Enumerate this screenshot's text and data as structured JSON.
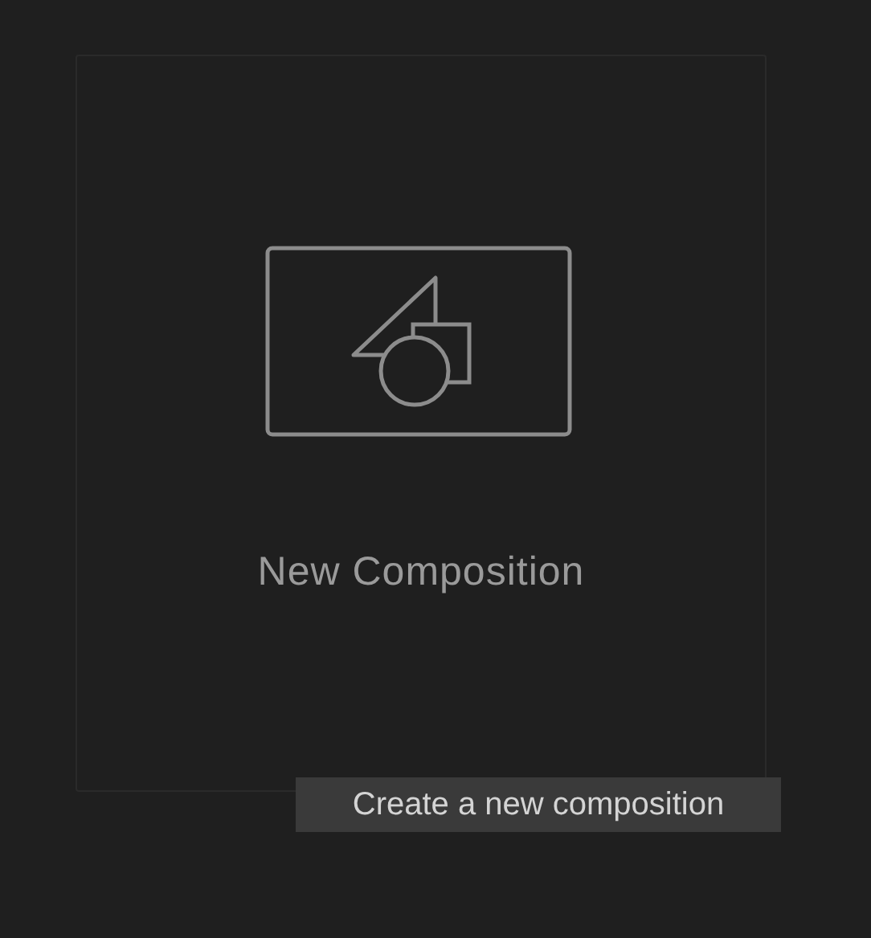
{
  "card": {
    "label": "New Composition"
  },
  "tooltip": {
    "text": "Create a new composition"
  }
}
